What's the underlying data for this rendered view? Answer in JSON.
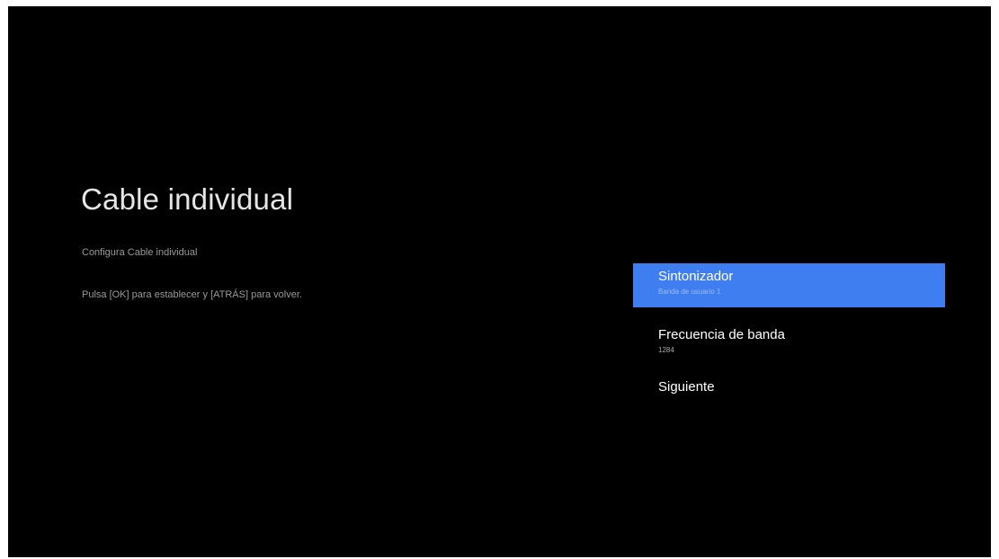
{
  "page": {
    "title": "Cable individual",
    "subtitle": "Configura Cable individual",
    "instruction": "Pulsa [OK] para establecer y [ATRÁS] para volver."
  },
  "menu": {
    "items": [
      {
        "label": "Sintonizador",
        "value": "Banda de usuario 1",
        "selected": true
      },
      {
        "label": "Frecuencia de banda",
        "value": "1284",
        "selected": false
      },
      {
        "label": "Siguiente",
        "selected": false
      }
    ]
  },
  "colors": {
    "background": "#000000",
    "selection": "#3f7ef0",
    "text_primary": "#ffffff",
    "text_secondary": "#9a9a9a"
  }
}
